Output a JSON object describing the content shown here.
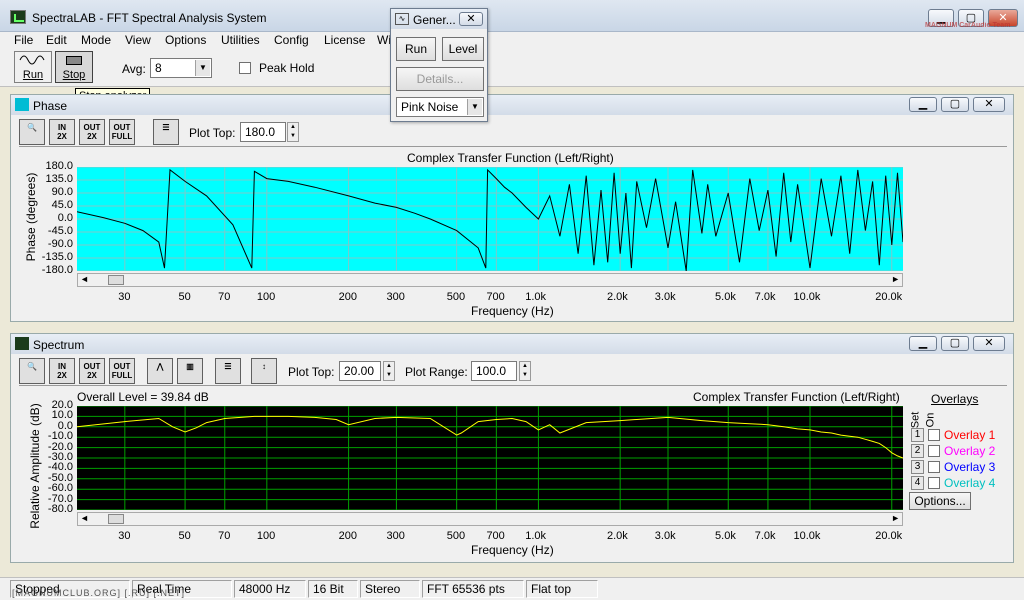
{
  "window": {
    "title": "SpectraLAB - FFT Spectral Analysis System",
    "watermark": "MAGNUM CarAudio Team"
  },
  "menu": [
    "File",
    "Edit",
    "Mode",
    "View",
    "Options",
    "Utilities",
    "Config",
    "License",
    "Wi"
  ],
  "toolbar": {
    "run_label": "Run",
    "stop_label": "Stop",
    "avg_label": "Avg:",
    "avg_value": "8",
    "peak_hold_label": "Peak Hold",
    "tooltip": "Stop analyzer"
  },
  "generator": {
    "title": "Gener...",
    "run_label": "Run",
    "level_label": "Level",
    "details_label": "Details...",
    "signal_value": "Pink Noise"
  },
  "phase_panel": {
    "title": "Phase",
    "plot_top_label": "Plot Top:",
    "plot_top_value": "180.0",
    "chart_title": "Complex Transfer Function (Left/Right)",
    "ylabel": "Phase (degrees)",
    "xlabel": "Frequency (Hz)",
    "yticks": [
      "180.0",
      "135.0",
      "90.0",
      "45.0",
      "0.0",
      "-45.0",
      "-90.0",
      "-135.0",
      "-180.0"
    ],
    "xticks": [
      "30",
      "50",
      "70",
      "100",
      "200",
      "300",
      "500",
      "700",
      "1.0k",
      "2.0k",
      "3.0k",
      "5.0k",
      "7.0k",
      "10.0k",
      "20.0k"
    ],
    "bg_color": "#00ffff",
    "line_color": "#000000"
  },
  "spectrum_panel": {
    "title": "Spectrum",
    "plot_top_label": "Plot Top:",
    "plot_top_value": "20.00",
    "plot_range_label": "Plot Range:",
    "plot_range_value": "100.0",
    "overall_level": "Overall Level = 39.84 dB",
    "chart_title": "Complex Transfer Function (Left/Right)",
    "ylabel": "Relative Amplitude (dB)",
    "xlabel": "Frequency (Hz)",
    "yticks": [
      "20.0",
      "10.0",
      "0.0",
      "-10.0",
      "-20.0",
      "-30.0",
      "-40.0",
      "-50.0",
      "-60.0",
      "-70.0",
      "-80.0"
    ],
    "xticks": [
      "30",
      "50",
      "70",
      "100",
      "200",
      "300",
      "500",
      "700",
      "1.0k",
      "2.0k",
      "3.0k",
      "5.0k",
      "7.0k",
      "10.0k",
      "20.0k"
    ],
    "bg_color": "#000000",
    "grid_color": "#00a000",
    "line_color": "#ffff00",
    "overlays": {
      "title": "Overlays",
      "set_label": "Set",
      "on_label": "On",
      "items": [
        {
          "n": "1",
          "label": "Overlay 1",
          "color": "#ff0000"
        },
        {
          "n": "2",
          "label": "Overlay 2",
          "color": "#ff00ff"
        },
        {
          "n": "3",
          "label": "Overlay 3",
          "color": "#0000ff"
        },
        {
          "n": "4",
          "label": "Overlay 4",
          "color": "#00c0c0"
        }
      ],
      "options_label": "Options..."
    }
  },
  "status": [
    "Stopped",
    "Real Time",
    "48000 Hz",
    "16 Bit",
    "Stereo",
    "FFT 65536 pts",
    "Flat top"
  ],
  "status_watermark": "[MAGNUMCLUB.ORG] [.RU] [.NET]",
  "chart_data": [
    {
      "type": "line",
      "title": "Complex Transfer Function (Left/Right)",
      "xlabel": "Frequency (Hz)",
      "ylabel": "Phase (degrees)",
      "xscale": "log",
      "xlim": [
        20,
        22000
      ],
      "ylim": [
        -180,
        180
      ],
      "grid": true,
      "series": [
        {
          "x": [
            20,
            25,
            30,
            35,
            40,
            42,
            44,
            50,
            60,
            75,
            88,
            90,
            100,
            120,
            150,
            200,
            250,
            300,
            350,
            400,
            500,
            600,
            640,
            650,
            700,
            750,
            800,
            900,
            1000,
            1100,
            1200,
            1300,
            1400,
            1500,
            1600,
            1700,
            1800,
            1900,
            2000,
            2100,
            2200,
            2300,
            2500,
            2700,
            3000,
            3200,
            3500,
            3700,
            4000,
            4200,
            4500,
            5000,
            5500,
            6000,
            6500,
            7000,
            7500,
            8000,
            8500,
            9000,
            10000,
            11000,
            12000,
            13000,
            14000,
            15000,
            16000,
            17000,
            18000,
            19000,
            20000,
            21000,
            22000
          ],
          "y": [
            25,
            5,
            -15,
            -40,
            -80,
            -170,
            170,
            130,
            80,
            -20,
            -170,
            165,
            140,
            130,
            110,
            80,
            55,
            40,
            20,
            0,
            -40,
            -100,
            -170,
            170,
            140,
            110,
            90,
            40,
            0,
            80,
            -60,
            120,
            -120,
            150,
            -160,
            100,
            -150,
            160,
            -120,
            90,
            -170,
            130,
            -30,
            140,
            -100,
            60,
            -180,
            170,
            -50,
            120,
            -60,
            90,
            -150,
            140,
            -40,
            100,
            -130,
            160,
            -80,
            120,
            -170,
            140,
            -60,
            150,
            -120,
            170,
            -40,
            130,
            -160,
            150,
            -90,
            160,
            -80
          ]
        }
      ]
    },
    {
      "type": "line",
      "title": "Complex Transfer Function (Left/Right)",
      "xlabel": "Frequency (Hz)",
      "ylabel": "Relative Amplitude (dB)",
      "xscale": "log",
      "xlim": [
        20,
        22000
      ],
      "ylim": [
        -80,
        20
      ],
      "grid": true,
      "series": [
        {
          "x": [
            20,
            30,
            40,
            45,
            50,
            55,
            60,
            70,
            80,
            90,
            100,
            120,
            150,
            180,
            200,
            250,
            300,
            400,
            500,
            520,
            600,
            700,
            800,
            900,
            1000,
            1100,
            1200,
            1500,
            2000,
            3000,
            4000,
            5000,
            6000,
            7000,
            8000,
            9000,
            10000,
            11000,
            12000,
            13000,
            14000,
            15000,
            16000,
            17000,
            18000,
            19000,
            20000,
            21000,
            22000
          ],
          "y": [
            0,
            5,
            8,
            0,
            -5,
            -1,
            4,
            8,
            9,
            10,
            10,
            10,
            9,
            7,
            2,
            8,
            9,
            8,
            -8,
            -6,
            5,
            7,
            8,
            5,
            -3,
            2,
            -6,
            4,
            6,
            9,
            6,
            4,
            3,
            2,
            0,
            -2,
            -3,
            -5,
            -6,
            -8,
            -9,
            -10,
            -12,
            -14,
            -16,
            -20,
            -25,
            -28,
            -30
          ]
        }
      ]
    }
  ]
}
